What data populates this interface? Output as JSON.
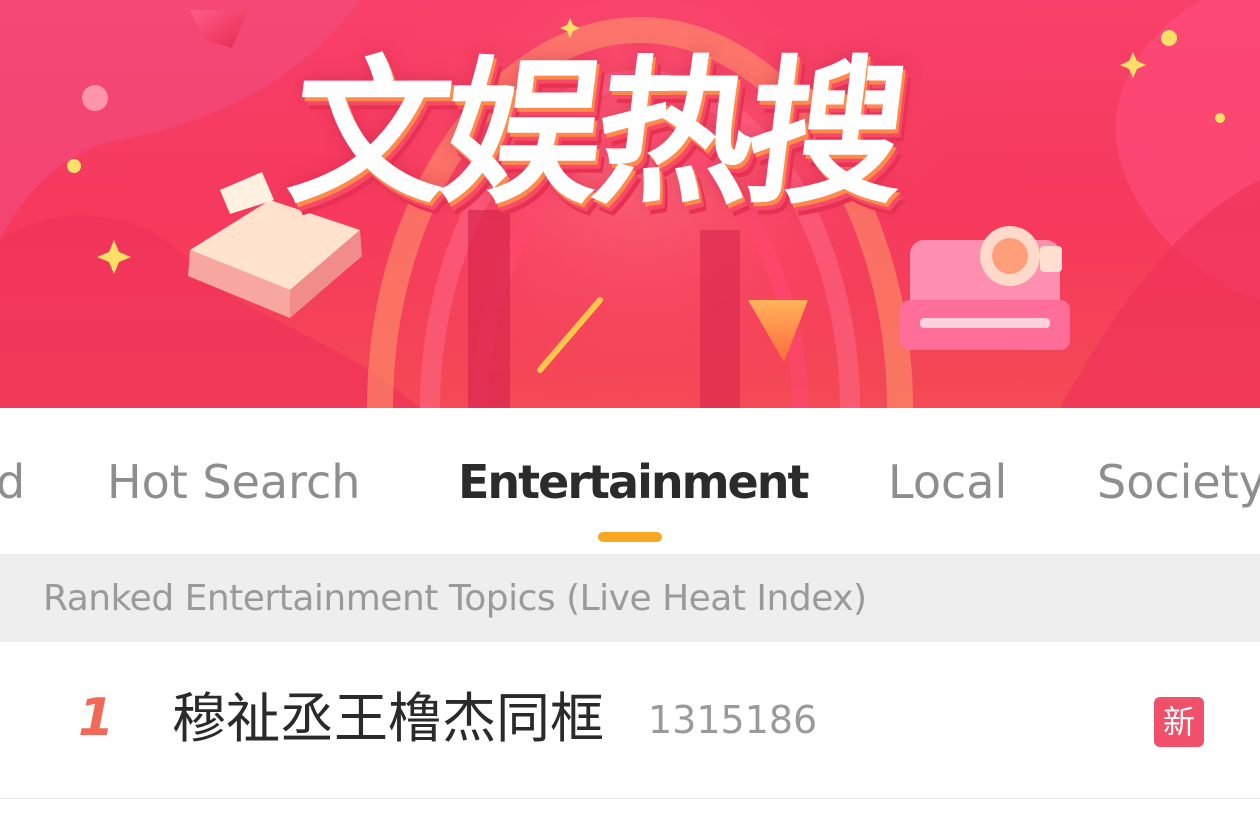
{
  "banner": {
    "title": "文娱热搜"
  },
  "tabs": [
    {
      "label": "d"
    },
    {
      "label": "Hot Search"
    },
    {
      "label": "Entertainment"
    },
    {
      "label": "Local"
    },
    {
      "label": "Society"
    }
  ],
  "active_tab": "Entertainment",
  "section_header": "Ranked Entertainment Topics (Live Heat Index)",
  "items": [
    {
      "rank": "1",
      "title": "穆祉丞王橹杰同框",
      "heat": "1315186",
      "badge": "新"
    }
  ],
  "colors": {
    "banner_red": "#f6395c",
    "tab_indicator": "#f7a823",
    "rank_color": "#f26a57",
    "badge_new": "#f0506a"
  },
  "icons": [
    "sparkle-icon",
    "book-icon",
    "camera-icon",
    "ribbon-arrow-icon",
    "prism-icon"
  ]
}
